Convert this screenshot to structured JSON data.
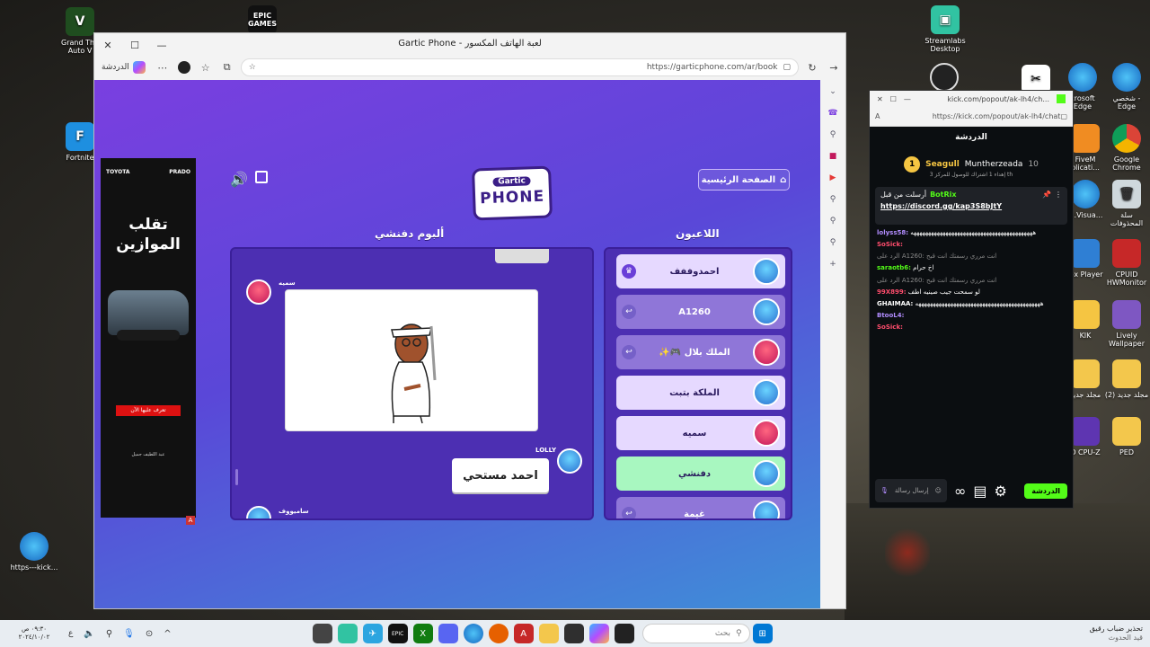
{
  "desktop": {
    "icons_left": [
      {
        "label": "Grand The\nAuto V",
        "icon": "gta-icon",
        "color": "#2b6a2b"
      },
      {
        "label": "Fortnite",
        "icon": "fortnite-icon",
        "color": "#1e8fe0"
      },
      {
        "label": "https---kick...",
        "icon": "edge-icon",
        "color": "#1a7fd0"
      }
    ],
    "icon_epic": {
      "label": "EPIC\nGAMES",
      "color": "#111"
    },
    "icons_right": [
      {
        "label": "Streamlabs\nDesktop",
        "color": "#31c3a2"
      },
      {
        "label": "crosoft\nEdge",
        "color": "#1a7fd0"
      },
      {
        "label": "شخصي -\nEdge",
        "color": "#1a7fd0"
      },
      {
        "label": "FiveM\nplicati...",
        "color": "#f08c22"
      },
      {
        "label": "Google\nChrome",
        "color": "#db4437"
      },
      {
        "label": "M.Visua...",
        "color": "#1a7fd0"
      },
      {
        "label": "سلة\nالمحذوفات",
        "color": "#cfd8dc"
      },
      {
        "label": "lox Player",
        "color": "#2f7fd4"
      },
      {
        "label": "CPUID\nHWMonitor",
        "color": "#c62828"
      },
      {
        "label": "KIK",
        "color": "#f5c542"
      },
      {
        "label": "Lively\nWallpaper",
        "color": "#7e57c2"
      },
      {
        "label": "مجلد جديد",
        "color": "#f3c74c"
      },
      {
        "label": "(2) مجلد جديد",
        "color": "#f3c74c"
      },
      {
        "label": "D CPU-Z",
        "color": "#5e35b1"
      },
      {
        "label": "PED",
        "color": "#f3c74c"
      }
    ]
  },
  "browser": {
    "title": "Gartic Phone - لعبة الهاتف المكسور",
    "copilot_label": "الدردشة",
    "url": "https://garticphone.com/ar/book",
    "window_buttons": [
      "✕",
      "☐",
      "—"
    ]
  },
  "ad": {
    "brand_left": "TOYOTA",
    "brand_right": "PRADO",
    "headline_line1": "تقلب",
    "headline_line2": "الموازين",
    "cta": "تعرف عليها الآن",
    "footer": "عبد اللطيف جميل"
  },
  "game": {
    "logo_top": "Gartic",
    "logo_bottom": "PHONE",
    "home_button": "الصفحة الرئيسية",
    "album_title": "ألبوم دفنشي",
    "players_title": "اللاعبون",
    "album": {
      "first_author": "سميه",
      "second_author": "LOLLY",
      "third_author": "ساميووف",
      "answer_text": "احمد مستحي"
    },
    "players": [
      {
        "name": "احمدوففف",
        "state": "host",
        "bg": "#e6d9ff",
        "badge": "♛"
      },
      {
        "name": "A1260",
        "state": "inactive",
        "bg": "#8f76d8",
        "badge": "↩"
      },
      {
        "name": "الملك بلال 🎮✨",
        "state": "inactive",
        "bg": "#8f76d8",
        "badge": "↩"
      },
      {
        "name": "الملكة بتبت",
        "state": "active",
        "bg": "#e6d9ff",
        "badge": ""
      },
      {
        "name": "سميه",
        "state": "active",
        "bg": "#e6d9ff",
        "badge": ""
      },
      {
        "name": "دفنشي",
        "state": "current",
        "bg": "#a8f7c0",
        "badge": ""
      },
      {
        "name": "غيمة",
        "state": "inactive",
        "bg": "#8f76d8",
        "badge": "↩"
      }
    ]
  },
  "chat": {
    "window_title": "kick.com/popout/ak-lh4/ch...",
    "url": "https://kick.com/popout/ak-lh4/chat",
    "header": "الدردشة",
    "leaders": [
      {
        "rank": "1",
        "name": "Seagull",
        "count": "10"
      },
      {
        "name": "Muntherzeada",
        "count": "10"
      }
    ],
    "leader_sub": "إهداء 1 اشتراك للوصول للمركز 3 th",
    "pinned_by": "أرسلت من قبل",
    "pinned_user": "BotRix",
    "pinned_link": "https://discord.gg/kap3S8bJtY",
    "messages": [
      {
        "user": "lolyss58:",
        "text": "ههههههههههههههههههههههههههههههههههههههههههه",
        "color": "#b28dff"
      },
      {
        "user": "SoSick:",
        "text": "",
        "color": "#ff4d6d"
      },
      {
        "user": "",
        "text": "الرد على A1260: انت مرري رسمتك انت قبح",
        "color": "#888"
      },
      {
        "user": "saraotb6:",
        "text": "اخ حرام",
        "color": "#53fc18"
      },
      {
        "user": "",
        "text": "الرد على A1260: انت مرري رسمتك انت قبح",
        "color": "#888"
      },
      {
        "user": "99X899:",
        "text": "لو سمحت جيب صينيه اطف",
        "color": "#ff4d6d"
      },
      {
        "user": "GHAIMAA:",
        "text": "هههههههههههههههههههههههههههههههههههههههههههه",
        "color": "#fff"
      },
      {
        "user": "BtooL4:",
        "text": "",
        "color": "#b28dff"
      },
      {
        "user": "SoSick:",
        "text": "",
        "color": "#ff4d6d"
      }
    ],
    "input_placeholder": "إرسال رسالة",
    "send_button": "الدردشة"
  },
  "taskbar": {
    "search_placeholder": "بحث",
    "clock": "٠٩:٣٠ ص",
    "date": "٢٠٢٤/١٠/٠٢",
    "notify_title": "تحذير ضباب رقيق",
    "notify_sub": "قيد الحدوث"
  }
}
